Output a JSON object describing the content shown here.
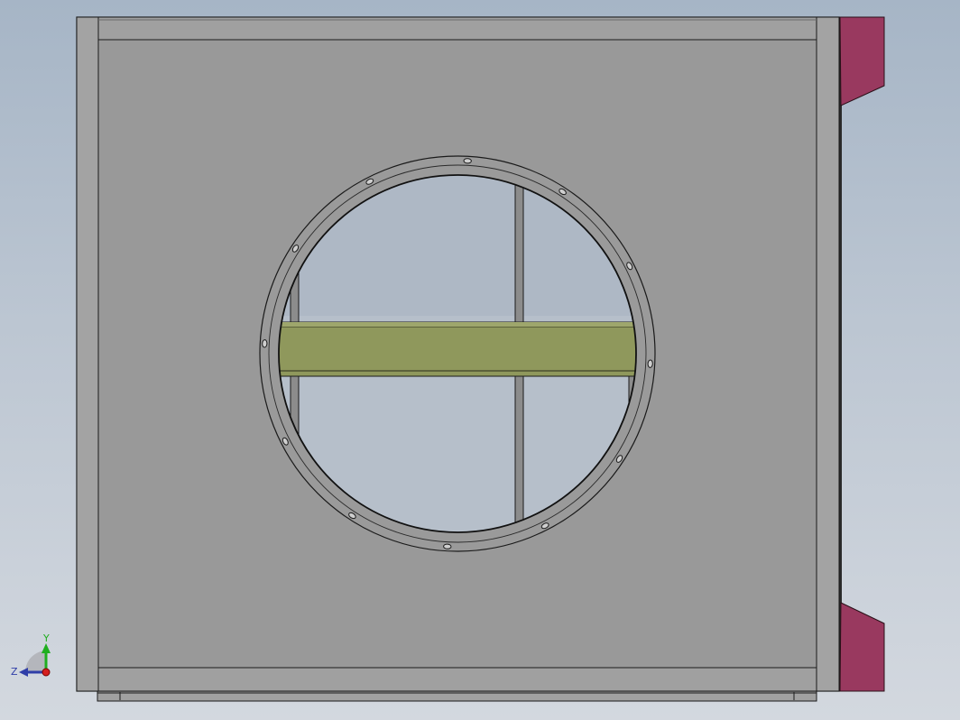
{
  "viewport": {
    "background_top": "#a6b5c6",
    "background_bottom": "#d3d8df"
  },
  "model": {
    "panel_color": "#999999",
    "frame_color": "#a3a3a3",
    "edge_color": "#1a1a1a",
    "damper_blade_color": "#8f985c",
    "bracket_color": "#99395f"
  },
  "triad": {
    "y_label": "Y",
    "z_label": "Z",
    "y_color": "#1fae1f",
    "z_color": "#2f3ea8",
    "origin_color": "#d41f1f"
  }
}
